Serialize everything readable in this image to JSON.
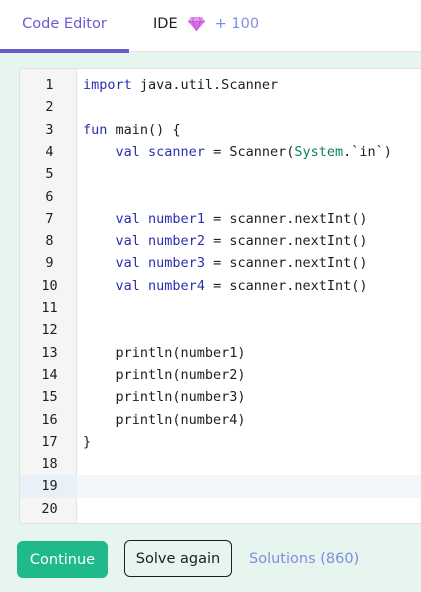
{
  "tabs": {
    "code_editor": "Code Editor",
    "ide": "IDE",
    "ide_bonus": "+ 100",
    "gem_icon": "gem-icon",
    "active_color": "#6a5bd0",
    "bonus_color": "#7f8de0",
    "gem_color": "#d86fe6"
  },
  "editor": {
    "active_line": 19,
    "lines": [
      {
        "number": "1",
        "tokens": [
          {
            "t": "import",
            "c": "kw"
          },
          {
            "t": " java.util.Scanner",
            "c": ""
          }
        ]
      },
      {
        "number": "2",
        "tokens": []
      },
      {
        "number": "3",
        "tokens": [
          {
            "t": "fun",
            "c": "kw"
          },
          {
            "t": " main() {",
            "c": ""
          }
        ]
      },
      {
        "number": "4",
        "tokens": [
          {
            "t": "    ",
            "c": ""
          },
          {
            "t": "val",
            "c": "kw"
          },
          {
            "t": " ",
            "c": ""
          },
          {
            "t": "scanner",
            "c": "vr"
          },
          {
            "t": " = Scanner(",
            "c": ""
          },
          {
            "t": "System",
            "c": "tp"
          },
          {
            "t": ".`in`)",
            "c": ""
          }
        ]
      },
      {
        "number": "5",
        "tokens": []
      },
      {
        "number": "6",
        "tokens": []
      },
      {
        "number": "7",
        "tokens": [
          {
            "t": "    ",
            "c": ""
          },
          {
            "t": "val",
            "c": "kw"
          },
          {
            "t": " ",
            "c": ""
          },
          {
            "t": "number1",
            "c": "vr"
          },
          {
            "t": " = scanner.nextInt()",
            "c": ""
          }
        ]
      },
      {
        "number": "8",
        "tokens": [
          {
            "t": "    ",
            "c": ""
          },
          {
            "t": "val",
            "c": "kw"
          },
          {
            "t": " ",
            "c": ""
          },
          {
            "t": "number2",
            "c": "vr"
          },
          {
            "t": " = scanner.nextInt()",
            "c": ""
          }
        ]
      },
      {
        "number": "9",
        "tokens": [
          {
            "t": "    ",
            "c": ""
          },
          {
            "t": "val",
            "c": "kw"
          },
          {
            "t": " ",
            "c": ""
          },
          {
            "t": "number3",
            "c": "vr"
          },
          {
            "t": " = scanner.nextInt()",
            "c": ""
          }
        ]
      },
      {
        "number": "10",
        "tokens": [
          {
            "t": "    ",
            "c": ""
          },
          {
            "t": "val",
            "c": "kw"
          },
          {
            "t": " ",
            "c": ""
          },
          {
            "t": "number4",
            "c": "vr"
          },
          {
            "t": " = scanner.nextInt()",
            "c": ""
          }
        ]
      },
      {
        "number": "11",
        "tokens": []
      },
      {
        "number": "12",
        "tokens": []
      },
      {
        "number": "13",
        "tokens": [
          {
            "t": "    println(number1)",
            "c": ""
          }
        ]
      },
      {
        "number": "14",
        "tokens": [
          {
            "t": "    println(number2)",
            "c": ""
          }
        ]
      },
      {
        "number": "15",
        "tokens": [
          {
            "t": "    println(number3)",
            "c": ""
          }
        ]
      },
      {
        "number": "16",
        "tokens": [
          {
            "t": "    println(number4)",
            "c": ""
          }
        ]
      },
      {
        "number": "17",
        "tokens": [
          {
            "t": "}",
            "c": ""
          }
        ]
      },
      {
        "number": "18",
        "tokens": []
      },
      {
        "number": "19",
        "tokens": []
      },
      {
        "number": "20",
        "tokens": []
      }
    ]
  },
  "footer": {
    "continue_label": "Continue",
    "solve_again_label": "Solve again",
    "solutions_label": "Solutions (860)",
    "continue_color": "#1fb98b"
  }
}
